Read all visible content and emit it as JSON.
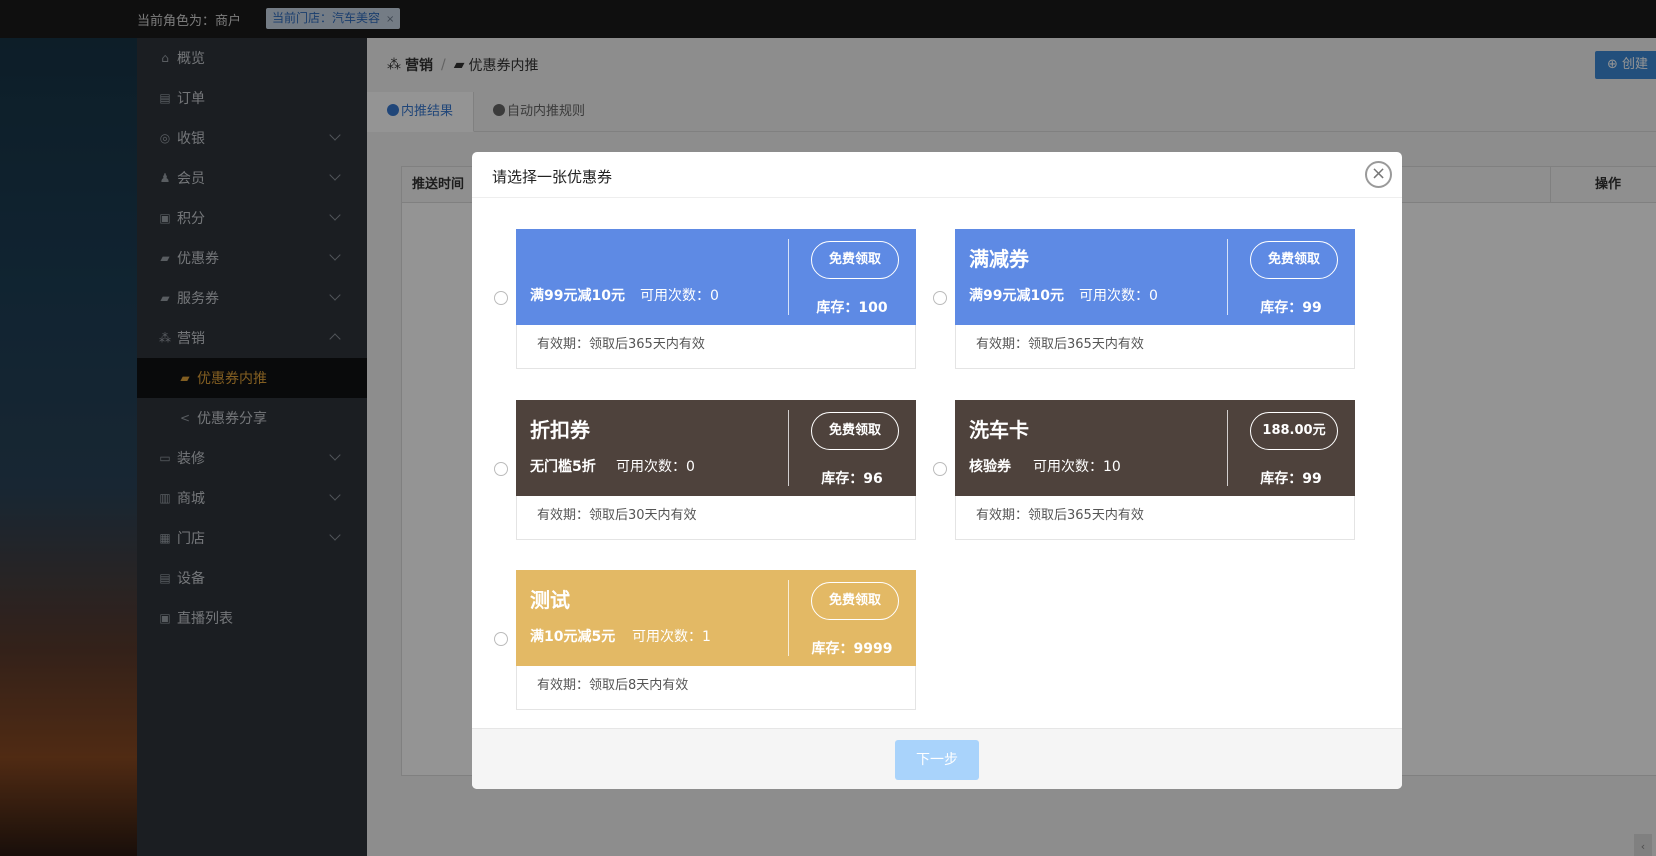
{
  "topbar": {
    "role": "当前角色为：商户",
    "store": "当前门店：汽车美容",
    "store_close": "×"
  },
  "sidebar": {
    "items": [
      {
        "label": "概览",
        "icon": "home-icon"
      },
      {
        "label": "订单",
        "icon": "order-icon"
      },
      {
        "label": "收银",
        "icon": "cashier-icon"
      },
      {
        "label": "会员",
        "icon": "member-icon"
      },
      {
        "label": "积分",
        "icon": "points-icon"
      },
      {
        "label": "优惠券",
        "icon": "coupon-icon"
      },
      {
        "label": "服务券",
        "icon": "service-coupon-icon"
      },
      {
        "label": "营销",
        "icon": "marketing-icon"
      },
      {
        "label": "优惠券内推",
        "icon": "coupon-icon"
      },
      {
        "label": "优惠券分享",
        "icon": "share-icon"
      },
      {
        "label": "装修",
        "icon": "decorate-icon"
      },
      {
        "label": "商城",
        "icon": "mall-icon"
      },
      {
        "label": "门店",
        "icon": "store-icon"
      },
      {
        "label": "设备",
        "icon": "device-icon"
      },
      {
        "label": "直播列表",
        "icon": "live-icon"
      }
    ]
  },
  "main": {
    "breadcrumb": {
      "parent": "营销",
      "sep": "/",
      "current": "优惠券内推"
    },
    "create_button": "创建",
    "tabs": [
      {
        "label": "内推结果"
      },
      {
        "label": "自动内推规则"
      }
    ],
    "table": {
      "col_time": "推送时间",
      "col_action": "操作"
    }
  },
  "modal": {
    "title": "请选择一张优惠券",
    "close": "×",
    "next": "下一步",
    "coupons": [
      {
        "title": "",
        "desc": "满99元减10元",
        "uses": "可用次数：0",
        "button": "免费领取",
        "stock": "库存：100",
        "validity": "有效期：领取后365天内有效",
        "color": "#5e8ae4"
      },
      {
        "title": "满减券",
        "desc": "满99元减10元",
        "uses": "可用次数：0",
        "button": "免费领取",
        "stock": "库存：99",
        "validity": "有效期：领取后365天内有效",
        "color": "#5e8ae4"
      },
      {
        "title": "折扣券",
        "desc": "无门槛5折",
        "uses": "可用次数：0",
        "button": "免费领取",
        "stock": "库存：96",
        "validity": "有效期：领取后30天内有效",
        "color": "#4e423c"
      },
      {
        "title": "洗车卡",
        "desc": "核验券",
        "uses": "可用次数：10",
        "button": "188.00元",
        "stock": "库存：99",
        "validity": "有效期：领取后365天内有效",
        "color": "#4e423c"
      },
      {
        "title": "测试",
        "desc": "满10元减5元",
        "uses": "可用次数：1",
        "button": "免费领取",
        "stock": "库存：9999",
        "validity": "有效期：领取后8天内有效",
        "color": "#e3b965"
      }
    ]
  },
  "colors": {
    "accent": "#3879d1",
    "active_menu": "#e0a23a",
    "next_button": "#a9d3fb"
  }
}
